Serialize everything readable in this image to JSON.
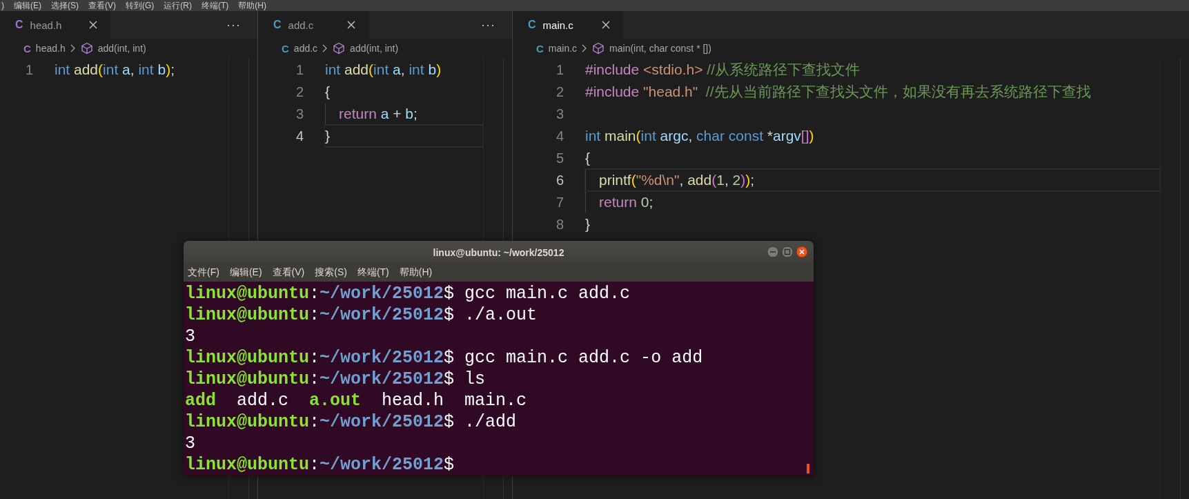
{
  "menu_bar": {
    "items": [
      ")",
      "编辑(E)",
      "选择(S)",
      "查看(V)",
      "转到(G)",
      "运行(R)",
      "终端(T)",
      "帮助(H)"
    ]
  },
  "editor_groups": [
    {
      "focused": false,
      "tab": {
        "label": "head.h",
        "icon": "C",
        "selected": true
      },
      "more": "···",
      "breadcrumb": {
        "icon": "C",
        "file": "head.h",
        "symbol": "add(int, int)"
      },
      "lines": [
        {
          "number": "1",
          "current": false,
          "tokens": [
            {
              "kind": "keyword",
              "text": "int "
            },
            {
              "kind": "func",
              "text": "add"
            },
            {
              "kind": "bracket",
              "text": "("
            },
            {
              "kind": "keyword",
              "text": "int "
            },
            {
              "kind": "var",
              "text": "a"
            },
            {
              "kind": "plain",
              "text": ", "
            },
            {
              "kind": "keyword",
              "text": "int "
            },
            {
              "kind": "var",
              "text": "b"
            },
            {
              "kind": "bracket",
              "text": ")"
            },
            {
              "kind": "plain",
              "text": ";"
            }
          ]
        }
      ]
    },
    {
      "focused": false,
      "tab": {
        "label": "add.c",
        "icon": "C",
        "selected": true
      },
      "more": "···",
      "breadcrumb": {
        "icon": "C",
        "file": "add.c",
        "symbol": "add(int, int)"
      },
      "lines": [
        {
          "number": "1",
          "current": false,
          "tokens": [
            {
              "kind": "keyword",
              "text": "int "
            },
            {
              "kind": "func",
              "text": "add"
            },
            {
              "kind": "bracket",
              "text": "("
            },
            {
              "kind": "keyword",
              "text": "int "
            },
            {
              "kind": "var",
              "text": "a"
            },
            {
              "kind": "plain",
              "text": ", "
            },
            {
              "kind": "keyword",
              "text": "int "
            },
            {
              "kind": "var",
              "text": "b"
            },
            {
              "kind": "bracket",
              "text": ")"
            }
          ]
        },
        {
          "number": "2",
          "current": false,
          "tokens": [
            {
              "kind": "plain",
              "text": "{"
            }
          ]
        },
        {
          "number": "3",
          "current": false,
          "indented": true,
          "tokens": [
            {
              "kind": "control",
              "text": "return "
            },
            {
              "kind": "var",
              "text": "a"
            },
            {
              "kind": "plain",
              "text": " + "
            },
            {
              "kind": "var",
              "text": "b"
            },
            {
              "kind": "plain",
              "text": ";"
            }
          ]
        },
        {
          "number": "4",
          "current": true,
          "tokens": [
            {
              "kind": "plain",
              "text": "}"
            }
          ]
        }
      ]
    },
    {
      "focused": true,
      "tab": {
        "label": "main.c",
        "icon": "C",
        "selected": true
      },
      "breadcrumb": {
        "icon": "C",
        "file": "main.c",
        "symbol": "main(int, char const * [])"
      },
      "lines": [
        {
          "number": "1",
          "current": false,
          "tokens": [
            {
              "kind": "control",
              "text": "#include "
            },
            {
              "kind": "string",
              "text": "<stdio.h>"
            },
            {
              "kind": "comment",
              "text": " //从系统路径下查找文件"
            }
          ]
        },
        {
          "number": "2",
          "current": false,
          "tokens": [
            {
              "kind": "control",
              "text": "#include "
            },
            {
              "kind": "string",
              "text": "\"head.h\""
            },
            {
              "kind": "comment",
              "text": "  //先从当前路径下查找头文件，如果没有再去系统路径下查找"
            }
          ]
        },
        {
          "number": "3",
          "current": false
        },
        {
          "number": "4",
          "current": false,
          "tokens": [
            {
              "kind": "keyword",
              "text": "int "
            },
            {
              "kind": "func",
              "text": "main"
            },
            {
              "kind": "bracket",
              "text": "("
            },
            {
              "kind": "keyword",
              "text": "int "
            },
            {
              "kind": "var",
              "text": "argc"
            },
            {
              "kind": "plain",
              "text": ", "
            },
            {
              "kind": "keyword",
              "text": "char const "
            },
            {
              "kind": "plain",
              "text": "*"
            },
            {
              "kind": "var",
              "text": "argv"
            },
            {
              "kind": "bracket2",
              "text": "[]"
            },
            {
              "kind": "bracket",
              "text": ")"
            }
          ]
        },
        {
          "number": "5",
          "current": false,
          "tokens": [
            {
              "kind": "plain",
              "text": "{"
            }
          ]
        },
        {
          "number": "6",
          "current": true,
          "indented": true,
          "tokens": [
            {
              "kind": "func",
              "text": "printf"
            },
            {
              "kind": "bracket",
              "text": "("
            },
            {
              "kind": "string",
              "text": "\"%d\\n\""
            },
            {
              "kind": "plain",
              "text": ", "
            },
            {
              "kind": "func",
              "text": "add"
            },
            {
              "kind": "bracket2",
              "text": "("
            },
            {
              "kind": "number",
              "text": "1"
            },
            {
              "kind": "plain",
              "text": ", "
            },
            {
              "kind": "number",
              "text": "2"
            },
            {
              "kind": "bracket2",
              "text": ")"
            },
            {
              "kind": "bracket",
              "text": ")"
            },
            {
              "kind": "plain",
              "text": ";"
            }
          ]
        },
        {
          "number": "7",
          "current": false,
          "indented": true,
          "tokens": [
            {
              "kind": "control",
              "text": "return "
            },
            {
              "kind": "number",
              "text": "0"
            },
            {
              "kind": "plain",
              "text": ";"
            }
          ]
        },
        {
          "number": "8",
          "current": false,
          "tokens": [
            {
              "kind": "plain",
              "text": "}"
            }
          ]
        }
      ]
    }
  ],
  "terminal": {
    "title": "linux@ubuntu: ~/work/25012",
    "menu": [
      "文件(F)",
      "编辑(E)",
      "查看(V)",
      "搜索(S)",
      "终端(T)",
      "帮助(H)"
    ],
    "lines": [
      [
        {
          "kind": "user",
          "text": "linux@ubuntu"
        },
        {
          "kind": "plain",
          "text": ":"
        },
        {
          "kind": "path",
          "text": "~/work/25012"
        },
        {
          "kind": "plain",
          "text": "$ gcc main.c add.c"
        }
      ],
      [
        {
          "kind": "user",
          "text": "linux@ubuntu"
        },
        {
          "kind": "plain",
          "text": ":"
        },
        {
          "kind": "path",
          "text": "~/work/25012"
        },
        {
          "kind": "plain",
          "text": "$ ./a.out"
        }
      ],
      [
        {
          "kind": "plain",
          "text": "3"
        }
      ],
      [
        {
          "kind": "user",
          "text": "linux@ubuntu"
        },
        {
          "kind": "plain",
          "text": ":"
        },
        {
          "kind": "path",
          "text": "~/work/25012"
        },
        {
          "kind": "plain",
          "text": "$ gcc main.c add.c -o add"
        }
      ],
      [
        {
          "kind": "user",
          "text": "linux@ubuntu"
        },
        {
          "kind": "plain",
          "text": ":"
        },
        {
          "kind": "path",
          "text": "~/work/25012"
        },
        {
          "kind": "plain",
          "text": "$ ls"
        }
      ],
      [
        {
          "kind": "exec",
          "text": "add"
        },
        {
          "kind": "plain",
          "text": "  add.c  "
        },
        {
          "kind": "exec",
          "text": "a.out"
        },
        {
          "kind": "plain",
          "text": "  head.h  main.c"
        }
      ],
      [
        {
          "kind": "user",
          "text": "linux@ubuntu"
        },
        {
          "kind": "plain",
          "text": ":"
        },
        {
          "kind": "path",
          "text": "~/work/25012"
        },
        {
          "kind": "plain",
          "text": "$ ./add"
        }
      ],
      [
        {
          "kind": "plain",
          "text": "3"
        }
      ],
      [
        {
          "kind": "user",
          "text": "linux@ubuntu"
        },
        {
          "kind": "plain",
          "text": ":"
        },
        {
          "kind": "path",
          "text": "~/work/25012"
        },
        {
          "kind": "plain",
          "text": "$"
        }
      ]
    ]
  }
}
